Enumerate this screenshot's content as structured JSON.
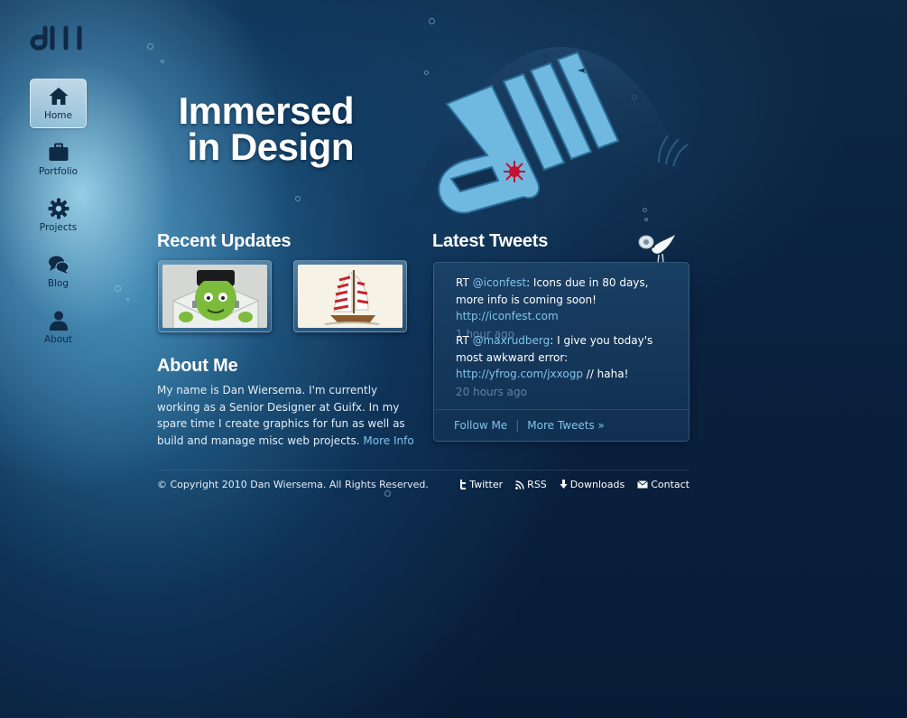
{
  "site": {
    "logo_text": "dw",
    "tagline_line1": "Immersed",
    "tagline_line2": "in Design"
  },
  "nav": {
    "items": [
      {
        "label": "Home",
        "icon": "home-icon",
        "active": true
      },
      {
        "label": "Portfolio",
        "icon": "briefcase-icon",
        "active": false
      },
      {
        "label": "Projects",
        "icon": "gear-icon",
        "active": false
      },
      {
        "label": "Blog",
        "icon": "chat-bubbles-icon",
        "active": false
      },
      {
        "label": "About",
        "icon": "person-icon",
        "active": false
      }
    ]
  },
  "updates": {
    "title": "Recent Updates"
  },
  "about": {
    "title": "About Me",
    "text": "My name is Dan Wiersema. I'm currently working as a Senior Designer at Guifx. In my spare time I create graphics for fun as well as build and manage misc web projects.",
    "more_label": "More Info"
  },
  "tweets": {
    "title": "Latest Tweets",
    "items": [
      {
        "prefix": "RT ",
        "handle": "@iconfest",
        "text": ": Icons due in 80 days, more info is coming soon! ",
        "link": "http://iconfest.com",
        "suffix": "",
        "time": "1 hour ago"
      },
      {
        "prefix": "RT ",
        "handle": "@maxrudberg",
        "text": ": I give you today's most awkward error: ",
        "link": "http://yfrog.com/jxxogp",
        "suffix": " // haha!",
        "time": "20 hours ago"
      }
    ],
    "follow_label": "Follow Me",
    "separator": "|",
    "more_label": "More Tweets »"
  },
  "footer": {
    "copyright": "© Copyright 2010 Dan Wiersema. All Rights Reserved.",
    "links": [
      {
        "label": "Twitter",
        "icon": "twitter-icon"
      },
      {
        "label": "RSS",
        "icon": "rss-icon"
      },
      {
        "label": "Downloads",
        "icon": "download-icon"
      },
      {
        "label": "Contact",
        "icon": "mail-icon"
      }
    ]
  },
  "colors": {
    "accent_link": "#7fc4ea",
    "background": "#0a2240",
    "timestamp": "#5d83a4"
  }
}
